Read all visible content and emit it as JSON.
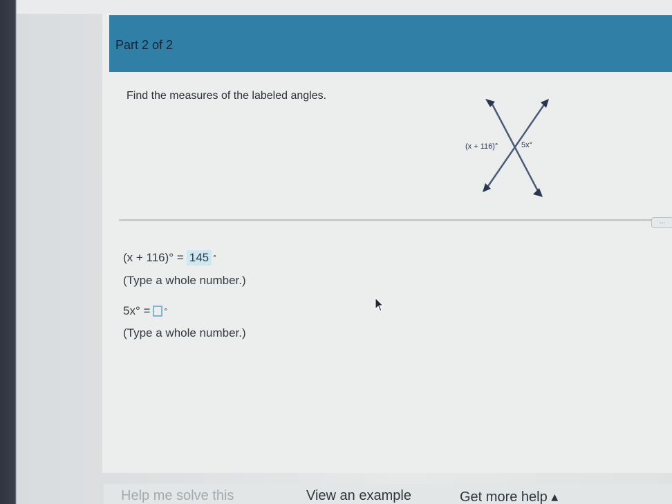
{
  "header": {
    "part_label": "Part 2 of 2"
  },
  "problem": {
    "instructions": "Find the measures of the labeled angles.",
    "figure": {
      "left_angle_label": "(x + 116)°",
      "right_angle_label": "5x°"
    }
  },
  "answers": [
    {
      "expression": "(x + 116)° =",
      "value": "145",
      "unit": "°",
      "hint": "(Type a whole number.)"
    },
    {
      "expression": "5x° =",
      "value": "",
      "unit": "°",
      "hint": "(Type a whole number.)"
    }
  ],
  "footer": {
    "help_solve": "Help me solve this",
    "view_example": "View an example",
    "more_help": "Get more help ▴"
  },
  "colors": {
    "header_bg": "#2f7fa7",
    "answer_highlight": "#cfe7f1"
  },
  "icons": [
    "arrow-up-left-icon",
    "arrow-up-right-icon",
    "arrow-down-left-icon",
    "arrow-down-right-icon",
    "mouse-cursor-icon"
  ]
}
